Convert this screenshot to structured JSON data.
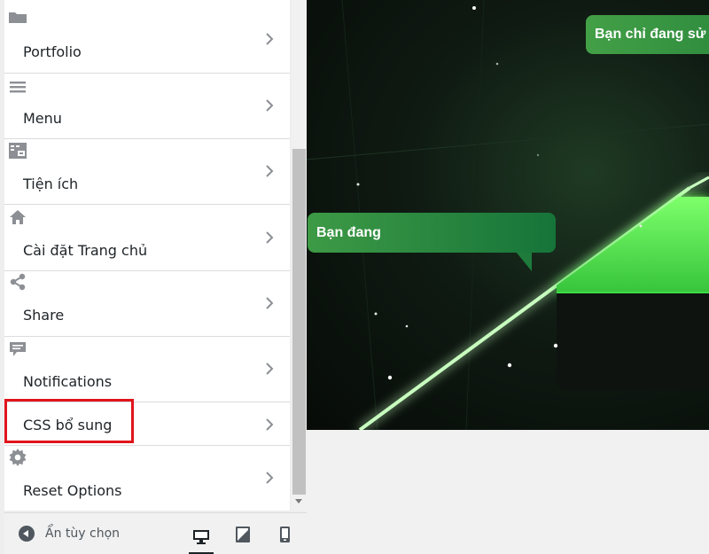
{
  "sidebar": {
    "sections": [
      {
        "label": "Portfolio",
        "icon": "folder-icon"
      },
      {
        "label": "Menu",
        "icon": "menu-icon"
      },
      {
        "label": "Tiện ích",
        "icon": "widgets-icon"
      },
      {
        "label": "Cài đặt Trang chủ",
        "icon": "home-icon"
      },
      {
        "label": "Share",
        "icon": "share-icon"
      },
      {
        "label": "Notifications",
        "icon": "notification-icon"
      },
      {
        "label": "CSS bổ sung",
        "icon": ""
      },
      {
        "label": "Reset Options",
        "icon": "gear-icon"
      }
    ],
    "highlighted_section": "CSS bổ sung"
  },
  "footer": {
    "collapse_label": "Ẩn tùy chọn",
    "devices": [
      "desktop",
      "tablet",
      "mobile"
    ],
    "active_device": "desktop"
  },
  "preview": {
    "bubble_top": "Bạn chỉ đang sử d",
    "bubble_left": "Bạn đang"
  },
  "colors": {
    "highlight": "#e0141b",
    "bubble_green": "#43a047"
  }
}
